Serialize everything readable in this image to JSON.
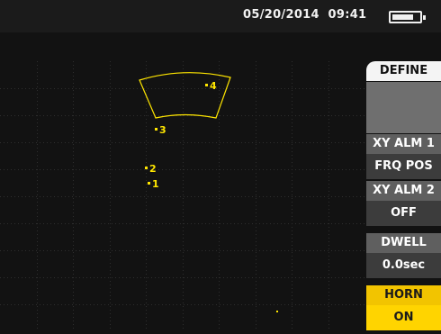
{
  "status": {
    "datetime": "05/20/2014  09:41",
    "battery_icon": "battery-icon",
    "battery_level": 0.8
  },
  "menu": {
    "title": "DEFINE",
    "items": [
      {
        "label": "XY ALM 1",
        "value": "FRQ POS",
        "active": false
      },
      {
        "label": "XY ALM 2",
        "value": "OFF",
        "active": false
      },
      {
        "label": "DWELL",
        "value": "0.0sec",
        "active": false
      },
      {
        "label": "HORN",
        "value": "ON",
        "active": true
      }
    ]
  },
  "plot": {
    "signal_color": "#ffe600",
    "markers": [
      {
        "label": "1"
      },
      {
        "label": "2"
      },
      {
        "label": "3"
      },
      {
        "label": "4"
      }
    ]
  }
}
